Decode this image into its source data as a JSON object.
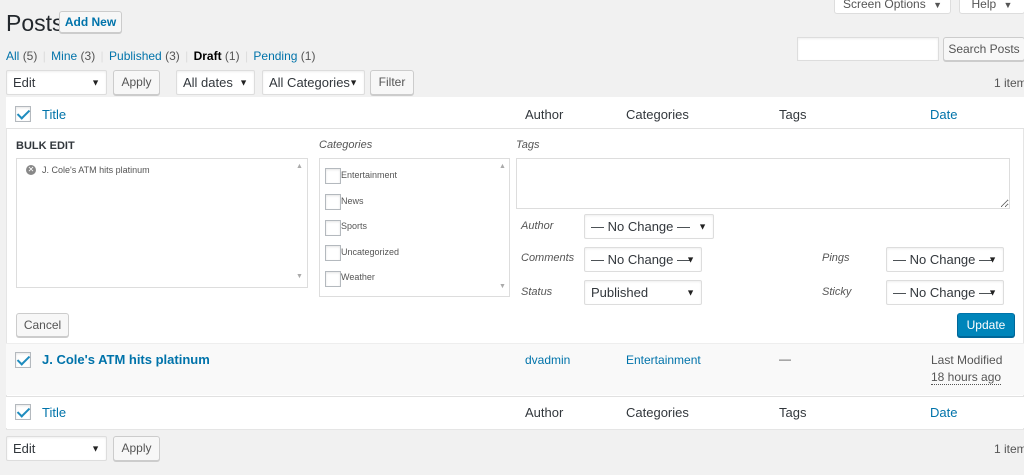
{
  "header": {
    "title": "Posts",
    "add_new": "Add New",
    "screen_options": "Screen Options",
    "help": "Help"
  },
  "filters": {
    "links": [
      {
        "label": "All",
        "count": "(5)"
      },
      {
        "label": "Mine",
        "count": "(3)"
      },
      {
        "label": "Published",
        "count": "(3)"
      },
      {
        "label": "Draft",
        "count": "(1)"
      },
      {
        "label": "Pending",
        "count": "(1)"
      }
    ],
    "separator": "|",
    "search_button": "Search Posts",
    "search_placeholder": ""
  },
  "toolbar_top": {
    "bulk_action": "Edit",
    "apply": "Apply",
    "dates": "All dates",
    "categories": "All Categories",
    "filter": "Filter",
    "items_count": "1 item"
  },
  "columns": {
    "title": "Title",
    "author": "Author",
    "categories": "Categories",
    "tags": "Tags",
    "date": "Date"
  },
  "bulk_edit": {
    "heading": "BULK EDIT",
    "post_item": "J. Cole's ATM hits platinum",
    "categories_label": "Categories",
    "categories": [
      "Entertainment",
      "News",
      "Sports",
      "Uncategorized",
      "Weather"
    ],
    "tags_label": "Tags",
    "author_label": "Author",
    "author_value": "— No Change —",
    "comments_label": "Comments",
    "comments_value": "— No Change —",
    "status_label": "Status",
    "status_value": "Published",
    "pings_label": "Pings",
    "pings_value": "— No Change —",
    "sticky_label": "Sticky",
    "sticky_value": "— No Change —",
    "cancel": "Cancel",
    "update": "Update"
  },
  "row": {
    "title": "J. Cole's ATM hits platinum",
    "author": "dvadmin",
    "category": "Entertainment",
    "tags": "—",
    "date_status": "Last Modified",
    "date_value": "18 hours ago"
  },
  "toolbar_bottom": {
    "bulk_action": "Edit",
    "apply": "Apply",
    "items_count": "1 item"
  },
  "colors": {
    "accent": "#0073aa",
    "primary_button": "#0085ba"
  }
}
